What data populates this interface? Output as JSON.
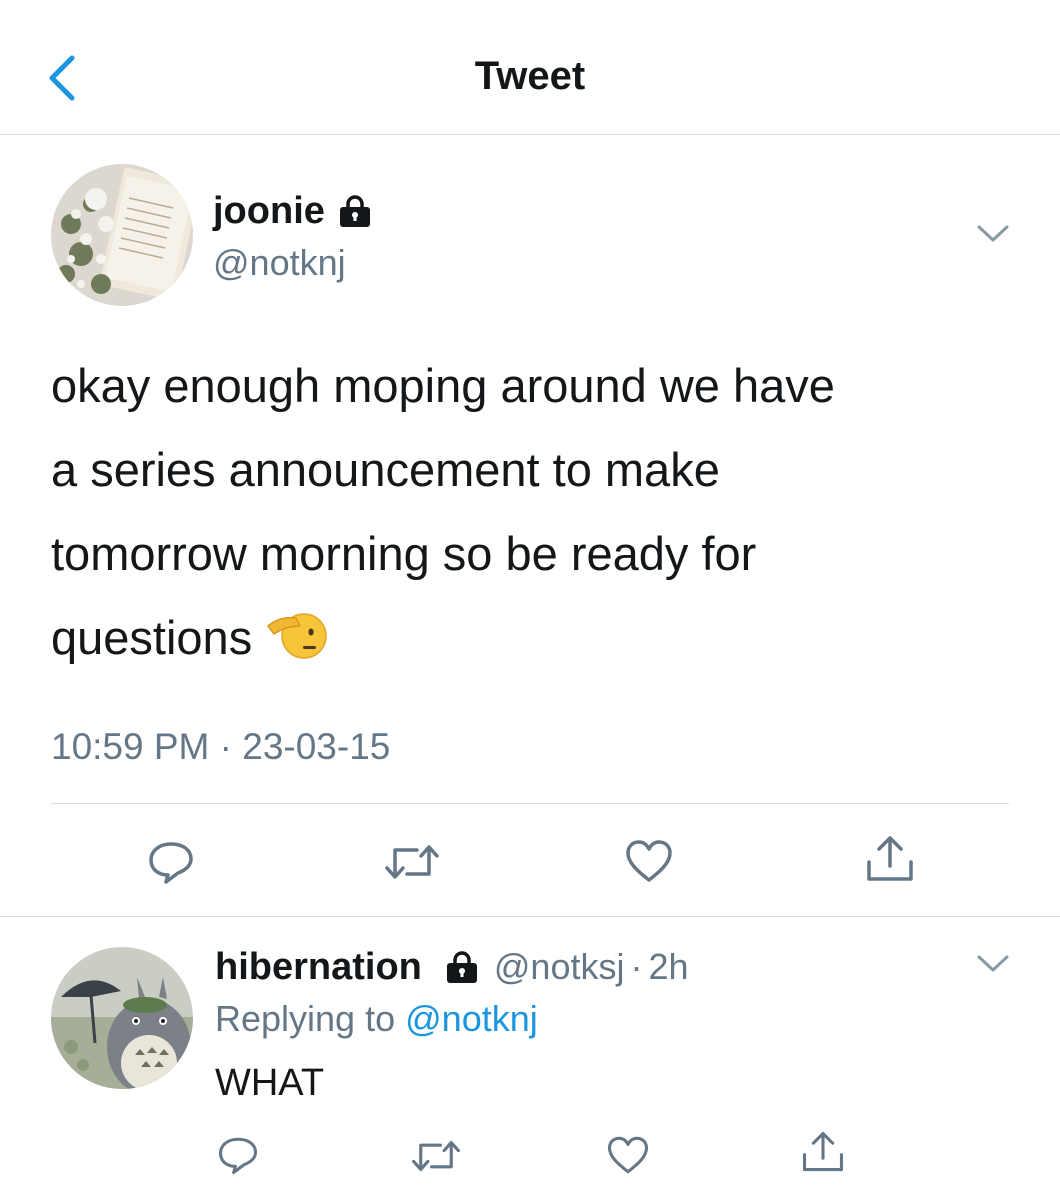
{
  "header": {
    "title": "Tweet",
    "back_icon": "chevron-left-icon",
    "accent_color": "#1b95e0"
  },
  "tweet": {
    "author_name": "joonie",
    "author_handle": "@notknj",
    "protected_icon": "lock-icon",
    "avatar": "book-and-flowers-photo",
    "text_lines": [
      "okay enough moping around we have",
      "a series announcement to make",
      "tomorrow morning so be ready for",
      "questions"
    ],
    "emoji": "saluting-face-emoji",
    "timestamp": "10:59 PM · 23-03-15",
    "more_icon": "chevron-down-icon",
    "actions": [
      "reply-icon",
      "retweet-icon",
      "like-icon",
      "share-icon"
    ]
  },
  "reply": {
    "author_name": "hibernation",
    "author_handle": "@notksj",
    "separator": "·",
    "time": "2h",
    "protected_icon": "lock-icon",
    "avatar": "totoro-illustration",
    "replying_prefix": "Replying to",
    "replying_to": "@notknj",
    "text": "WHAT",
    "more_icon": "chevron-down-icon",
    "actions": [
      "reply-icon",
      "retweet-icon",
      "like-icon",
      "share-icon"
    ]
  }
}
